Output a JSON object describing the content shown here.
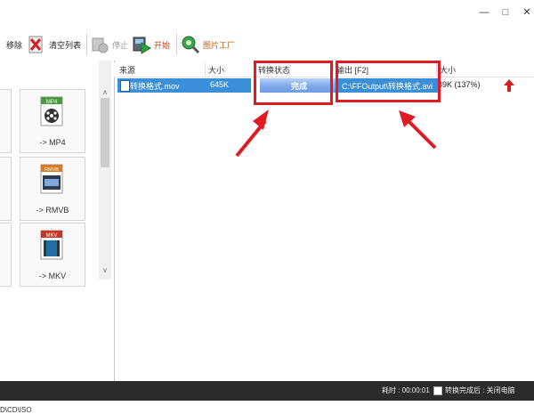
{
  "window": {
    "min": "—",
    "max": "□",
    "close": "✕"
  },
  "toolbar": {
    "remove_label": "移除",
    "clear_label": "清空列表",
    "stop_label": "停止",
    "start_label": "开始",
    "picture_factory_label": "图片工厂"
  },
  "formats": [
    {
      "badge": "MP4",
      "label": "-> MP4"
    },
    {
      "badge": "RMVB",
      "label": "-> RMVB"
    },
    {
      "badge": "MKV",
      "label": "-> MKV"
    }
  ],
  "left_footer_path": "D\\CD\\ISO",
  "list": {
    "columns": [
      "来源",
      "大小",
      "转换状态",
      "输出 [F2]",
      "大小"
    ],
    "rows": [
      {
        "source": "转换格式.mov",
        "size": "645K",
        "status": "完成",
        "output": "C:\\FFOutput\\转换格式.avi",
        "output_size": "89K  (137%)"
      }
    ]
  },
  "statusbar": {
    "elapsed": "耗时 : 00:00:01",
    "after_done": "转换完成后 : 关闭电脑"
  },
  "colors": {
    "selection": "#3b8fd9",
    "annotation": "#e01b24"
  }
}
